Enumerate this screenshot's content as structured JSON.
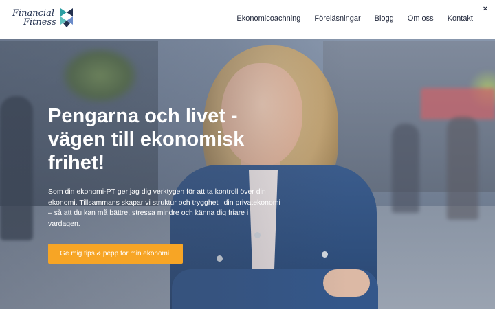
{
  "header": {
    "logo": {
      "line1": "Financial",
      "line2": "Fitness"
    },
    "nav": [
      {
        "label": "Ekonomicoachning"
      },
      {
        "label": "Föreläsningar"
      },
      {
        "label": "Blogg"
      },
      {
        "label": "Om oss"
      },
      {
        "label": "Kontakt"
      }
    ],
    "close_label": "×"
  },
  "hero": {
    "headline": "Pengarna och livet - vägen till ekonomisk frihet!",
    "body": "Som din ekonomi-PT ger jag dig verktygen för att ta kontroll över din ekonomi. Tillsammans skapar vi struktur och trygghet i din privatekonomi – så att du kan må bättre, stressa mindre och känna dig friare i vardagen.",
    "cta_label": "Ge mig tips & pepp för min ekonomi!"
  },
  "colors": {
    "header_bg": "#ffffff",
    "brand_navy": "#23314f",
    "cta": "#f7a525",
    "hero_text": "#ffffff"
  }
}
